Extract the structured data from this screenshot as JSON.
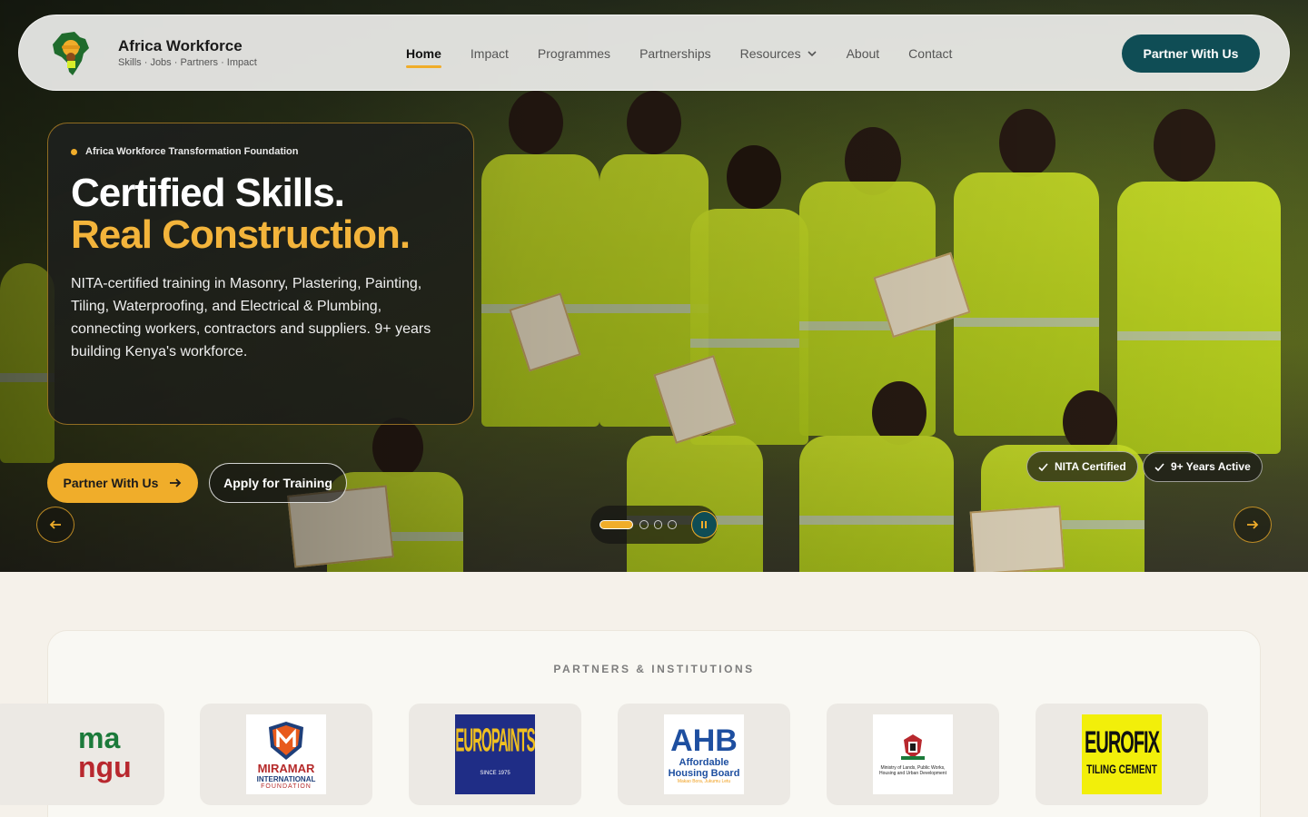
{
  "nav": {
    "brand_title": "Africa Workforce",
    "brand_subtitle": "Skills · Jobs · Partners · Impact",
    "items": [
      {
        "label": "Home",
        "active": true
      },
      {
        "label": "Impact"
      },
      {
        "label": "Programmes"
      },
      {
        "label": "Partnerships"
      },
      {
        "label": "Resources",
        "dropdown": true
      },
      {
        "label": "About"
      },
      {
        "label": "Contact"
      }
    ],
    "cta_label": "Partner With Us"
  },
  "hero": {
    "eyebrow": "Africa Workforce Transformation Foundation",
    "headline_line1": "Certified Skills.",
    "headline_line2": "Real Construction.",
    "description": "NITA-certified training in Masonry, Plastering, Painting, Tiling, Waterproofing, and Electrical & Plumbing, connecting workers, contractors and suppliers. 9+ years building Kenya's workforce.",
    "primary_button": "Partner With Us",
    "secondary_button": "Apply for Training",
    "badges": [
      "NITA Certified",
      "9+ Years Active"
    ],
    "slide_count": 4,
    "active_slide": 1
  },
  "partners": {
    "title": "PARTNERS & INSTITUTIONS",
    "logos": [
      {
        "text_top": "ma",
        "text_bottom": "ngu"
      },
      {
        "line1": "MIRAMAR",
        "line2": "INTERNATIONAL",
        "line3": "FOUNDATION"
      },
      {
        "line1": "EUROPAINTS",
        "line2": "SINCE 1975"
      },
      {
        "line1": "AHB",
        "line2": "Affordable",
        "line3": "Housing Board",
        "line4": "Makao Bora, Jukumu Letu"
      },
      {
        "line1": "Ministry of Lands, Public Works,",
        "line2": "Housing and Urban Development"
      },
      {
        "line1": "EUROFIX",
        "line2": "TILING CEMENT"
      }
    ]
  },
  "colors": {
    "accent": "#f0ad2a",
    "brand_teal": "#0f4d55",
    "vest": "#c9e21f"
  }
}
